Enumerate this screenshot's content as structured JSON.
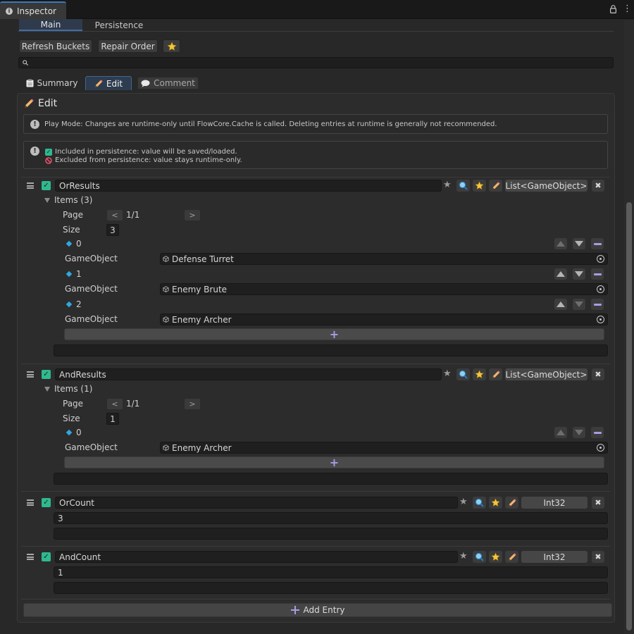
{
  "window": {
    "tab_title": "Inspector"
  },
  "main_tabs": [
    {
      "label": "Main"
    },
    {
      "label": "Persistence"
    }
  ],
  "toolbar": {
    "refresh_label": "Refresh Buckets",
    "repair_label": "Repair Order"
  },
  "sub_tabs": [
    {
      "label": "Summary"
    },
    {
      "label": "Edit"
    },
    {
      "label": "Comment"
    }
  ],
  "panel": {
    "title": "Edit",
    "help1": "Play Mode: Changes are runtime-only until FlowCore.Cache is called. Deleting entries at runtime is generally not recommended.",
    "help2_included": "Included in persistence: value will be saved/loaded.",
    "help2_excluded": "Excluded from persistence: value stays runtime-only."
  },
  "entries": [
    {
      "name": "OrResults",
      "type": "List<GameObject>",
      "items_label": "Items (3)",
      "page_label": "Page",
      "page_value": "1/1",
      "page_prev": "<",
      "page_next": ">",
      "size_label": "Size",
      "size_value": "3",
      "items": [
        {
          "index": "0",
          "field_label": "GameObject",
          "value": "Defense Turret"
        },
        {
          "index": "1",
          "field_label": "GameObject",
          "value": "Enemy Brute"
        },
        {
          "index": "2",
          "field_label": "GameObject",
          "value": "Enemy Archer"
        }
      ]
    },
    {
      "name": "AndResults",
      "type": "List<GameObject>",
      "items_label": "Items (1)",
      "page_label": "Page",
      "page_value": "1/1",
      "page_prev": "<",
      "page_next": ">",
      "size_label": "Size",
      "size_value": "1",
      "items": [
        {
          "index": "0",
          "field_label": "GameObject",
          "value": "Enemy Archer"
        }
      ]
    },
    {
      "name": "OrCount",
      "type": "Int32",
      "value": "3"
    },
    {
      "name": "AndCount",
      "type": "Int32",
      "value": "1"
    }
  ],
  "footer": {
    "add_entry_label": "Add Entry"
  },
  "icons": [
    "info-icon",
    "lock-icon",
    "menu-icon",
    "star-icon",
    "search-icon",
    "clipboard-icon",
    "pencil-icon",
    "speech-bubble-icon",
    "checkbox-icon",
    "forbidden-icon",
    "drag-handle-icon",
    "search-magnifier-icon",
    "pencil-icon",
    "close-icon",
    "cube-icon",
    "object-picker-icon",
    "plus-icon"
  ],
  "colors": {
    "accent_blue": "#3a79bb",
    "checkbox_green": "#2fb98f",
    "remove_purple": "#a79de0",
    "index_diamond": "#2ea8e0",
    "star_yellow": "#f3c63b"
  }
}
